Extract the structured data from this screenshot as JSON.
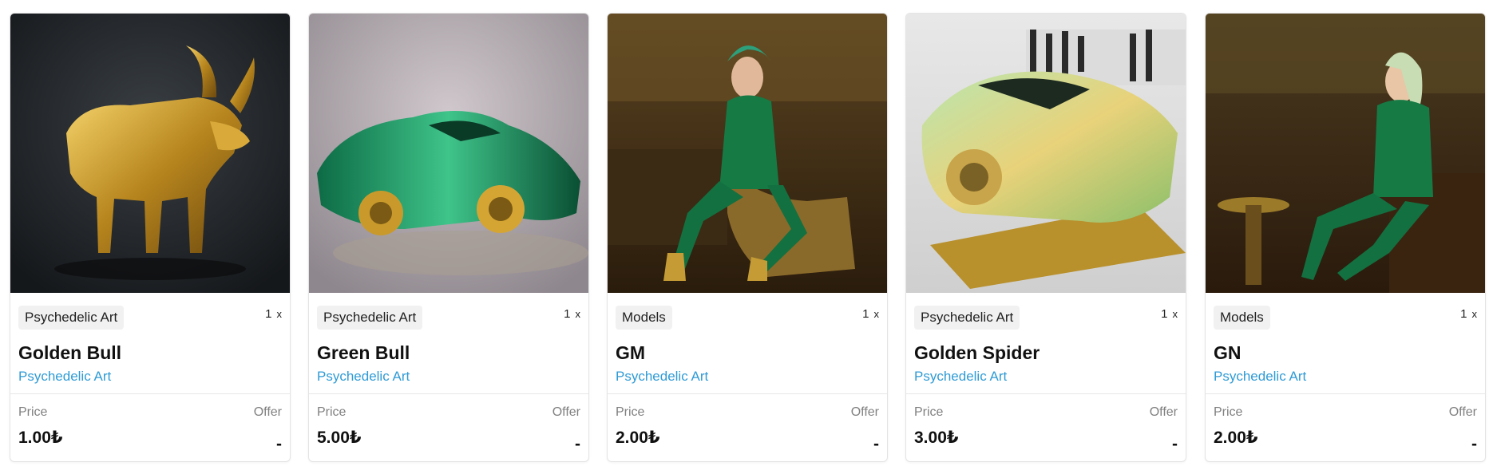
{
  "currency_symbol": "₺",
  "colors": {
    "link": "#2f9bd6",
    "badge_bg": "#f1f1f1",
    "border": "#e4e4e4"
  },
  "cards": [
    {
      "image_name": "golden-bull-image",
      "category": "Psychedelic Art",
      "quantity": "1",
      "quantity_suffix": "x",
      "title": "Golden Bull",
      "collection": "Psychedelic Art",
      "price_label": "Price",
      "price": "1.00₺",
      "offer_label": "Offer",
      "offer": "-"
    },
    {
      "image_name": "green-car-image",
      "category": "Psychedelic Art",
      "quantity": "1",
      "quantity_suffix": "x",
      "title": "Green Bull",
      "collection": "Psychedelic Art",
      "price_label": "Price",
      "price": "5.00₺",
      "offer_label": "Offer",
      "offer": "-"
    },
    {
      "image_name": "green-suit-woman-image",
      "category": "Models",
      "quantity": "1",
      "quantity_suffix": "x",
      "title": "GM",
      "collection": "Psychedelic Art",
      "price_label": "Price",
      "price": "2.00₺",
      "offer_label": "Offer",
      "offer": "-"
    },
    {
      "image_name": "golden-spider-car-image",
      "category": "Psychedelic Art",
      "quantity": "1",
      "quantity_suffix": "x",
      "title": "Golden Spider",
      "collection": "Psychedelic Art",
      "price_label": "Price",
      "price": "3.00₺",
      "offer_label": "Offer",
      "offer": "-"
    },
    {
      "image_name": "green-suit-model-bar-image",
      "category": "Models",
      "quantity": "1",
      "quantity_suffix": "x",
      "title": "GN",
      "collection": "Psychedelic Art",
      "price_label": "Price",
      "price": "2.00₺",
      "offer_label": "Offer",
      "offer": "-"
    }
  ]
}
